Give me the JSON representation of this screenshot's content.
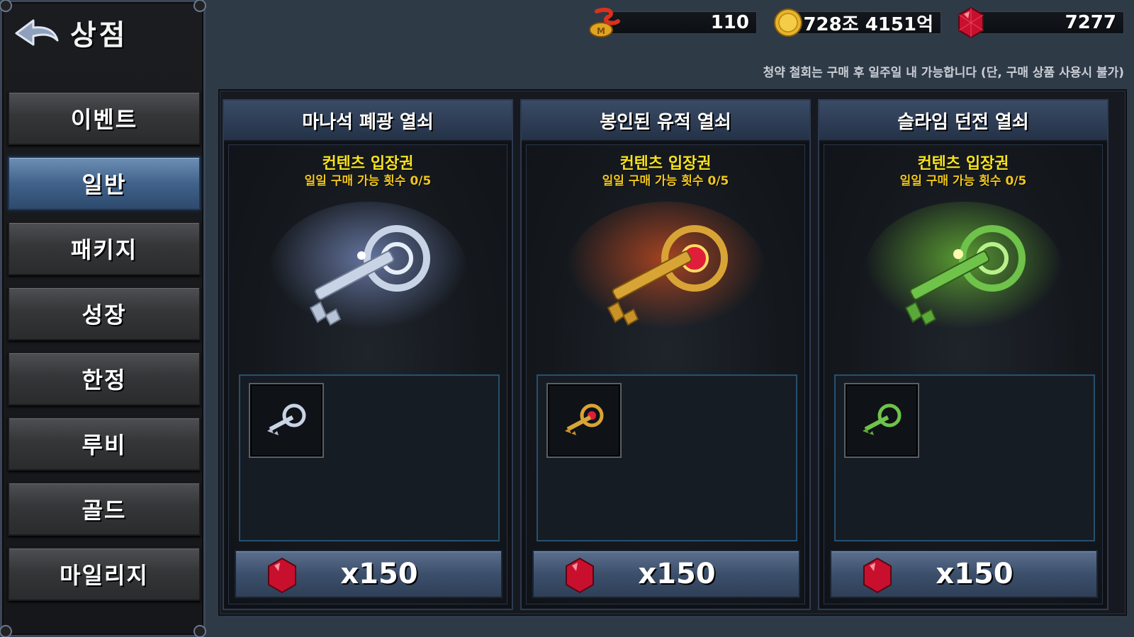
{
  "header": {
    "title": "상점"
  },
  "sidebar": {
    "items": [
      {
        "label": "이벤트"
      },
      {
        "label": "일반"
      },
      {
        "label": "패키지"
      },
      {
        "label": "성장"
      },
      {
        "label": "한정"
      },
      {
        "label": "루비"
      },
      {
        "label": "골드"
      },
      {
        "label": "마일리지"
      }
    ],
    "active_index": 1
  },
  "currencies": {
    "mileage": {
      "icon": "mileage-coin-icon",
      "value": "110"
    },
    "gold": {
      "icon": "gold-coin-icon",
      "value": "728조 4151억"
    },
    "ruby": {
      "icon": "ruby-icon",
      "value": "7277"
    }
  },
  "notice": "청약 철회는 구매 후 일주일 내 가능합니다 (단, 구매 상품 사용시 불가)",
  "products": [
    {
      "name": "마나석 폐광 열쇠",
      "ticket": "컨텐츠 입장권",
      "limit": "일일 구매 가능 횟수 0/5",
      "price": "x150",
      "key_color": "#c8d4e6",
      "glow_color": "#9fb8ff",
      "icon": "silver-key-icon"
    },
    {
      "name": "봉인된 유적 열쇠",
      "ticket": "컨텐츠 입장권",
      "limit": "일일 구매 가능 횟수 0/5",
      "price": "x150",
      "key_color": "#d9a436",
      "glow_color": "#ff5a1e",
      "icon": "gold-key-icon"
    },
    {
      "name": "슬라임 던전 열쇠",
      "ticket": "컨텐츠 입장권",
      "limit": "일일 구매 가능 횟수 0/5",
      "price": "x150",
      "key_color": "#6fc24a",
      "glow_color": "#8cff3a",
      "icon": "green-key-icon"
    }
  ],
  "colors": {
    "accent": "#41628a",
    "ticket_text": "#f7e21f",
    "limit_text": "#f0c61d"
  }
}
